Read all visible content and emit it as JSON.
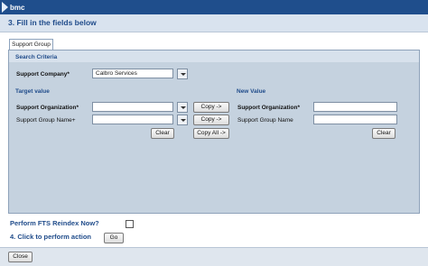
{
  "brand": "bmc",
  "step3_title": "3. Fill in the fields below",
  "tab_label": "Support Group",
  "search_criteria": {
    "heading": "Search Criteria",
    "company_label": "Support Company*",
    "company_value": "Calbro Services"
  },
  "target": {
    "heading": "Target value",
    "org_label": "Support Organization*",
    "org_value": "",
    "group_label": "Support Group Name+",
    "group_value": "",
    "clear_label": "Clear"
  },
  "copy_buttons": {
    "copy1": "Copy ->",
    "copy2": "Copy ->",
    "copy_all": "Copy All ->"
  },
  "new_value": {
    "heading": "New Value",
    "org_label": "Support Organization*",
    "org_value": "",
    "group_label": "Support Group Name",
    "group_value": "",
    "clear_label": "Clear"
  },
  "fts_label": "Perform FTS Reindex Now?",
  "step4_label": "4. Click to perform action",
  "go_label": "Go",
  "close_label": "Close",
  "colors": {
    "brand_bar": "#1f4e8c",
    "panel": "#c5d2df",
    "heading_blue": "#1f4b8a"
  }
}
